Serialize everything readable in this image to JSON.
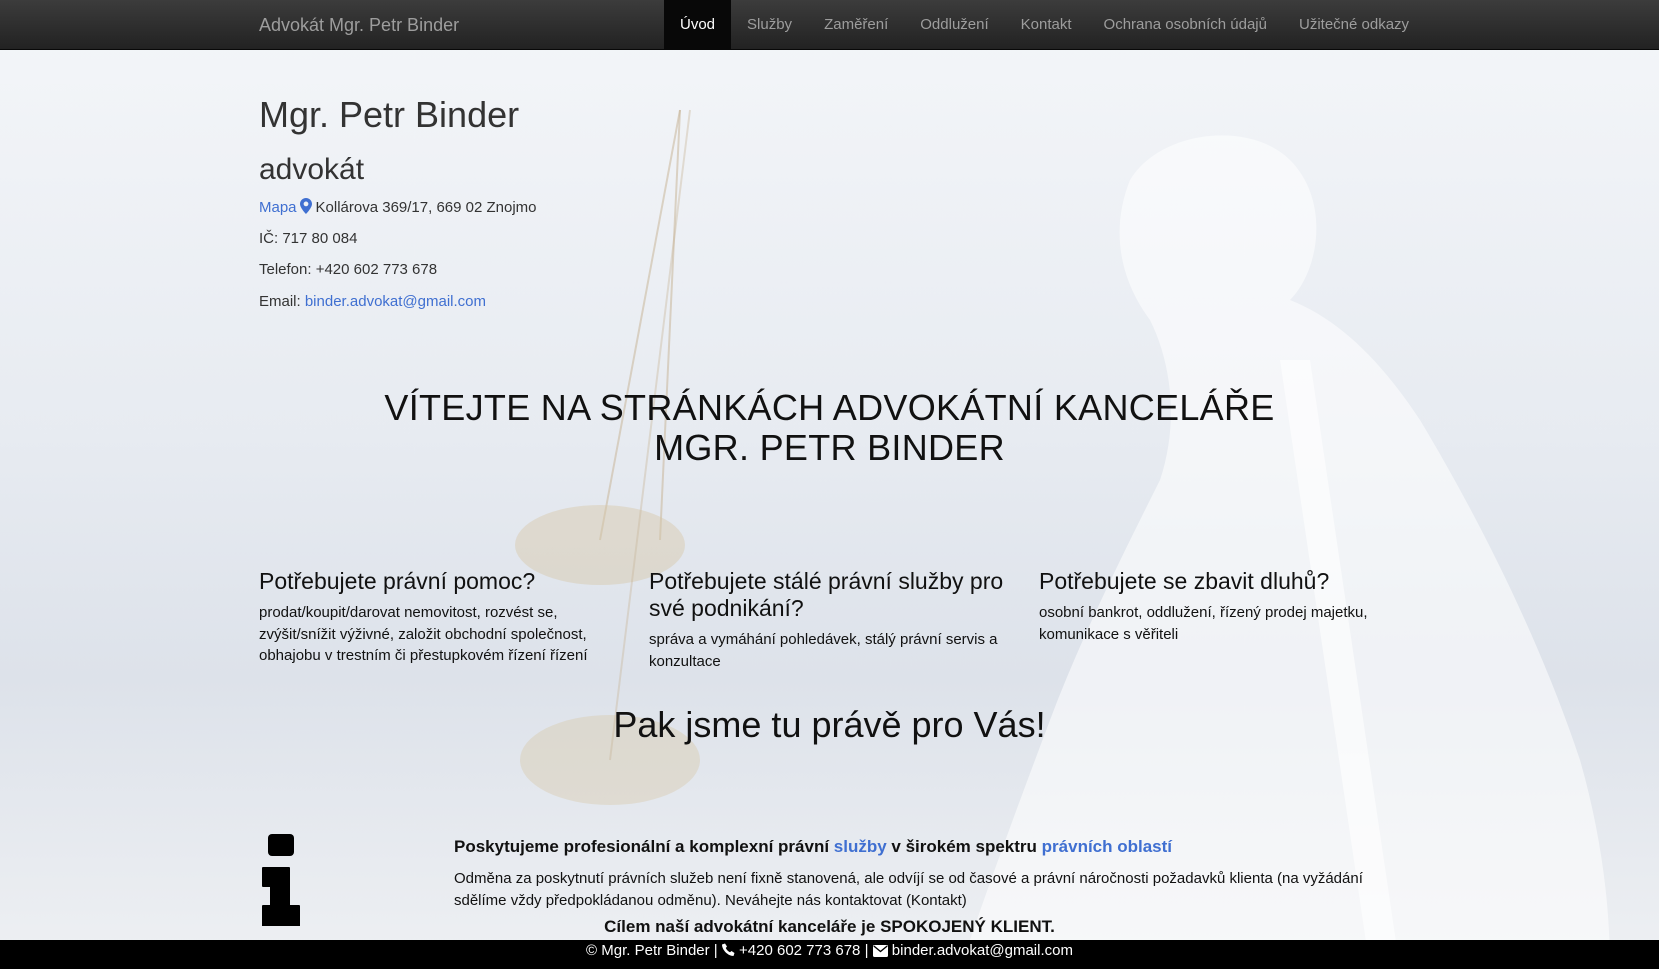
{
  "navbar": {
    "brand": "Advokát Mgr. Petr Binder",
    "items": [
      {
        "label": "Úvod",
        "active": true
      },
      {
        "label": "Služby"
      },
      {
        "label": "Zaměření"
      },
      {
        "label": "Oddlužení"
      },
      {
        "label": "Kontakt"
      },
      {
        "label": "Ochrana osobních údajů"
      },
      {
        "label": "Užitečné odkazy"
      }
    ]
  },
  "header": {
    "name": "Mgr. Petr Binder",
    "role": "advokát",
    "map_link": "Mapa",
    "map_icon": "map-marker-icon",
    "address": "Kollárova 369/17, 669 02 Znojmo",
    "ic": "IČ: 717 80 084",
    "phone": "Telefon: +420 602 773 678",
    "email_label": "Email: ",
    "email": "binder.advokat@gmail.com"
  },
  "welcome": {
    "line1": "VÍTEJTE NA STRÁNKÁCH ADVOKÁTNÍ KANCELÁŘE",
    "line2": "MGR. PETR BINDER"
  },
  "columns": [
    {
      "title": "Potřebujete právní pomoc?",
      "text": "prodat/koupit/darovat nemovitost, rozvést se, zvýšit/snížit výživné, založit obchodní společnost, obhajobu v trestním či přestupkovém řízení řízení"
    },
    {
      "title": "Potřebujete stálé právní služby pro své podnikání?",
      "text": "správa a vymáhání pohledávek, stálý právní servis a konzultace"
    },
    {
      "title": "Potřebujete se zbavit dluhů?",
      "text": "osobní bankrot, oddlužení, řízený prodej majetku, komunikace s věřiteli"
    }
  ],
  "slogan": "Pak jsme tu právě pro Vás!",
  "services": {
    "icon": "info-icon",
    "head_part1": "Poskytujeme profesionální a komplexní právní ",
    "head_link1": "služby",
    "head_part2": " v širokém spektru ",
    "head_link2": "právních oblastí",
    "text": "Odměna za poskytnutí právních služeb není fixně stanovená, ale odvíjí se od časové a právní náročnosti požadavků klienta (na vyžádání sdělíme vždy předpokládanou odměnu). Neváhejte nás kontaktovat (Kontakt)"
  },
  "goal": "Cílem naší advokátní kanceláře je SPOKOJENÝ KLIENT.",
  "footer": {
    "copyright": "© Mgr. Petr Binder | ",
    "phone": " +420 602 773 678 | ",
    "email": " binder.advokat@gmail.com",
    "phone_icon": "phone-icon",
    "email_icon": "envelope-icon"
  },
  "colors": {
    "link": "#3f6fd1",
    "navbar": "#222222",
    "nav_active": "#080808",
    "footer": "#000000"
  }
}
